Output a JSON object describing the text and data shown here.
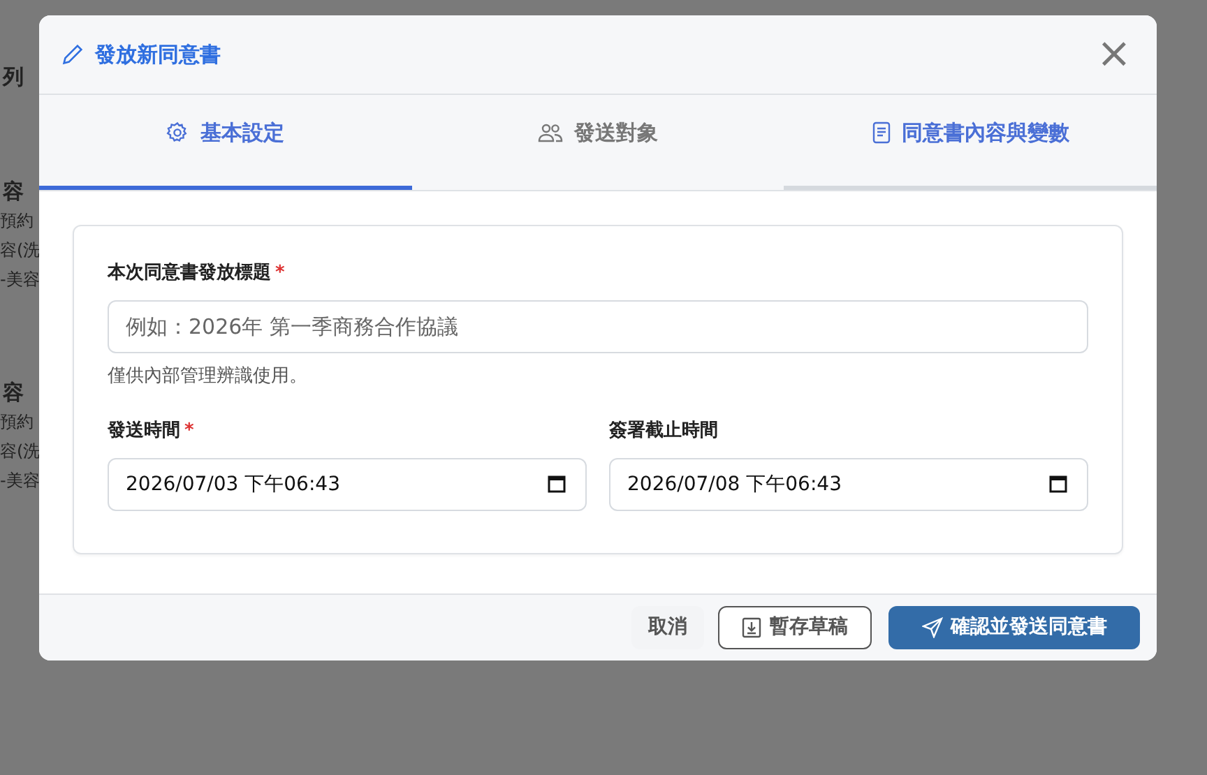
{
  "background": {
    "heading": "列",
    "items": [
      {
        "title": "容",
        "lines": [
          "預約",
          "容(洗",
          "-美容"
        ]
      },
      {
        "title": "容",
        "lines": [
          "預約",
          "容(洗",
          "-美容"
        ]
      }
    ]
  },
  "dialog": {
    "title": "發放新同意書",
    "close": "×"
  },
  "tabs": [
    {
      "label": "基本設定",
      "selected": true,
      "hovered": false
    },
    {
      "label": "發送對象",
      "selected": false,
      "hovered": false
    },
    {
      "label": "同意書內容與變數",
      "selected": false,
      "hovered": true
    }
  ],
  "form": {
    "title_field": {
      "label": "本次同意書發放標題",
      "required_mark": "*",
      "placeholder": "例如：2026年 第一季商務合作協議",
      "help": "僅供內部管理辨識使用。"
    },
    "date_fields": [
      {
        "label": "發送時間",
        "required_mark": "*",
        "value": "2026/07/03 下午06:43"
      },
      {
        "label": "簽署截止時間",
        "value": "2026/07/08 下午06:43"
      }
    ]
  },
  "buttons": [
    {
      "kind": "cancel",
      "label": "取消"
    },
    {
      "kind": "draft",
      "label": "暫存草稿"
    },
    {
      "kind": "send",
      "label": "確認並發送同意書"
    }
  ]
}
